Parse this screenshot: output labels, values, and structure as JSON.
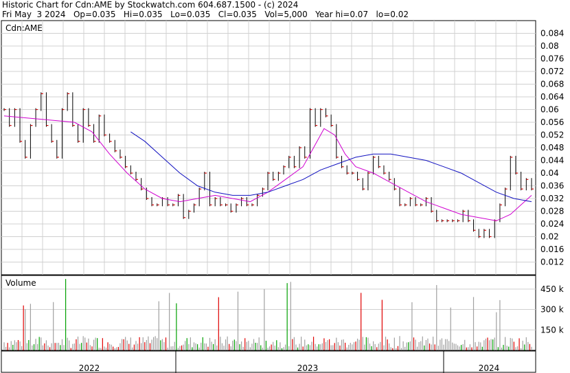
{
  "header": {
    "line1": "Historic Chart for Cdn:AME by Stockwatch.com 604.687.1500 - (c) 2024",
    "line2": "Fri May  3 2024   Op=0.035   Hi=0.035   Lo=0.035   Cl=0.035   Vol=5,000   Year hi=0.07   lo=0.02"
  },
  "chart_data": [
    {
      "type": "line",
      "title": "Cdn:AME",
      "ylim": [
        0.008,
        0.088
      ],
      "yticks": [
        "0.012",
        "0.016",
        "0.02",
        "0.024",
        "0.028",
        "0.032",
        "0.036",
        "0.04",
        "0.044",
        "0.048",
        "0.052",
        "0.056",
        "0.06",
        "0.064",
        "0.068",
        "0.072",
        "0.076",
        "0.08",
        "0.084"
      ],
      "grid": true,
      "x_years": [
        "2022",
        "2023",
        "2024"
      ],
      "series": [
        {
          "style": "ohlc-bars",
          "points": [
            [
              0.0,
              0.06
            ],
            [
              1.5,
              0.055
            ],
            [
              3,
              0.06
            ],
            [
              4.5,
              0.05
            ],
            [
              6,
              0.045
            ],
            [
              7.5,
              0.055
            ],
            [
              9,
              0.06
            ],
            [
              10.5,
              0.065
            ],
            [
              12,
              0.055
            ],
            [
              13.5,
              0.05
            ],
            [
              15,
              0.045
            ],
            [
              16.5,
              0.06
            ],
            [
              18,
              0.065
            ],
            [
              19.5,
              0.055
            ],
            [
              21,
              0.05
            ],
            [
              22.5,
              0.06
            ],
            [
              24,
              0.055
            ],
            [
              25.5,
              0.05
            ],
            [
              27,
              0.058
            ],
            [
              28.5,
              0.052
            ],
            [
              30,
              0.05
            ],
            [
              31.5,
              0.047
            ],
            [
              33,
              0.045
            ],
            [
              34.5,
              0.042
            ],
            [
              36,
              0.04
            ],
            [
              37.5,
              0.038
            ],
            [
              39,
              0.035
            ],
            [
              40.5,
              0.032
            ],
            [
              42,
              0.03
            ],
            [
              43.5,
              0.03
            ],
            [
              45,
              0.032
            ],
            [
              46.5,
              0.03
            ],
            [
              48,
              0.03
            ],
            [
              49.5,
              0.033
            ],
            [
              51,
              0.026
            ],
            [
              52.5,
              0.028
            ],
            [
              54,
              0.03
            ],
            [
              55.5,
              0.035
            ],
            [
              57,
              0.04
            ],
            [
              58.5,
              0.03
            ],
            [
              60,
              0.032
            ],
            [
              61.5,
              0.03
            ],
            [
              63,
              0.03
            ],
            [
              64.5,
              0.028
            ],
            [
              66,
              0.03
            ],
            [
              67.5,
              0.032
            ],
            [
              69,
              0.03
            ],
            [
              70.5,
              0.03
            ],
            [
              72,
              0.033
            ],
            [
              73.5,
              0.035
            ],
            [
              75,
              0.04
            ],
            [
              76.5,
              0.038
            ],
            [
              78,
              0.04
            ],
            [
              79.5,
              0.042
            ],
            [
              81,
              0.045
            ],
            [
              82.5,
              0.042
            ],
            [
              84,
              0.048
            ],
            [
              85.5,
              0.045
            ],
            [
              87,
              0.06
            ],
            [
              88.5,
              0.055
            ],
            [
              90,
              0.06
            ],
            [
              91.5,
              0.058
            ],
            [
              93,
              0.055
            ],
            [
              94.5,
              0.045
            ],
            [
              96,
              0.042
            ],
            [
              97.5,
              0.04
            ],
            [
              99,
              0.04
            ],
            [
              100.5,
              0.038
            ],
            [
              102,
              0.035
            ],
            [
              103.5,
              0.04
            ],
            [
              105,
              0.045
            ],
            [
              106.5,
              0.042
            ],
            [
              108,
              0.04
            ],
            [
              109.5,
              0.038
            ],
            [
              111,
              0.035
            ],
            [
              112.5,
              0.03
            ],
            [
              114,
              0.03
            ],
            [
              115.5,
              0.032
            ],
            [
              117,
              0.03
            ],
            [
              118.5,
              0.03
            ],
            [
              120,
              0.032
            ],
            [
              121.5,
              0.028
            ],
            [
              123,
              0.025
            ],
            [
              124.5,
              0.025
            ],
            [
              126,
              0.025
            ],
            [
              127.5,
              0.025
            ],
            [
              129,
              0.025
            ],
            [
              130.5,
              0.028
            ],
            [
              132,
              0.025
            ],
            [
              133.5,
              0.022
            ],
            [
              135,
              0.02
            ],
            [
              136.5,
              0.022
            ],
            [
              138,
              0.02
            ],
            [
              139.5,
              0.025
            ],
            [
              141,
              0.03
            ],
            [
              142.5,
              0.035
            ],
            [
              144,
              0.045
            ],
            [
              145.5,
              0.04
            ],
            [
              147,
              0.035
            ],
            [
              148.5,
              0.038
            ],
            [
              150,
              0.035
            ]
          ]
        },
        {
          "style": "moving-average",
          "color": "#d000d0",
          "points": [
            [
              0,
              0.058
            ],
            [
              10,
              0.057
            ],
            [
              20,
              0.056
            ],
            [
              25,
              0.053
            ],
            [
              30,
              0.046
            ],
            [
              35,
              0.04
            ],
            [
              40,
              0.035
            ],
            [
              45,
              0.032
            ],
            [
              50,
              0.031
            ],
            [
              55,
              0.032
            ],
            [
              60,
              0.033
            ],
            [
              65,
              0.032
            ],
            [
              70,
              0.031
            ],
            [
              75,
              0.034
            ],
            [
              80,
              0.038
            ],
            [
              85,
              0.042
            ],
            [
              88,
              0.048
            ],
            [
              91,
              0.054
            ],
            [
              94,
              0.052
            ],
            [
              97,
              0.046
            ],
            [
              100,
              0.042
            ],
            [
              105,
              0.04
            ],
            [
              110,
              0.037
            ],
            [
              115,
              0.034
            ],
            [
              120,
              0.031
            ],
            [
              125,
              0.029
            ],
            [
              130,
              0.027
            ],
            [
              135,
              0.026
            ],
            [
              140,
              0.025
            ],
            [
              144,
              0.027
            ],
            [
              147,
              0.03
            ],
            [
              150,
              0.033
            ]
          ]
        },
        {
          "style": "moving-average",
          "color": "#1010c0",
          "points": [
            [
              36,
              0.053
            ],
            [
              40,
              0.05
            ],
            [
              45,
              0.045
            ],
            [
              50,
              0.04
            ],
            [
              55,
              0.036
            ],
            [
              60,
              0.034
            ],
            [
              65,
              0.033
            ],
            [
              70,
              0.033
            ],
            [
              75,
              0.034
            ],
            [
              80,
              0.036
            ],
            [
              85,
              0.038
            ],
            [
              90,
              0.041
            ],
            [
              95,
              0.043
            ],
            [
              100,
              0.045
            ],
            [
              105,
              0.046
            ],
            [
              110,
              0.046
            ],
            [
              115,
              0.045
            ],
            [
              120,
              0.044
            ],
            [
              125,
              0.042
            ],
            [
              130,
              0.04
            ],
            [
              135,
              0.037
            ],
            [
              140,
              0.034
            ],
            [
              145,
              0.032
            ],
            [
              150,
              0.031
            ]
          ]
        }
      ]
    },
    {
      "type": "bar",
      "title": "Volume",
      "yticks": [
        "150 k",
        "300 k",
        "450 k"
      ],
      "ylim": [
        0,
        550000
      ],
      "colors": {
        "up": "#00a000",
        "down": "#e00000",
        "flat": "#a0a0a0"
      }
    }
  ]
}
